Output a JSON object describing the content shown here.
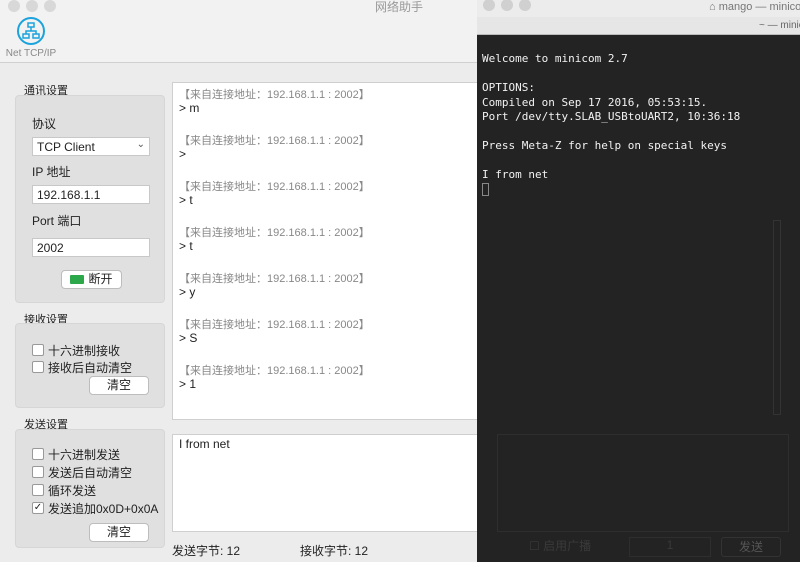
{
  "window": {
    "title": "网络助手",
    "tool_label": "Net TCP/IP"
  },
  "comm": {
    "title": "通讯设置",
    "protocol_label": "协议",
    "protocol_value": "TCP Client",
    "ip_label": "IP 地址",
    "ip_value": "192.168.1.1",
    "port_label": "Port 端口",
    "port_value": "2002",
    "disconnect_label": "断开"
  },
  "recv": {
    "title": "接收设置",
    "hex": "十六进制接收",
    "auto_clear": "接收后自动清空",
    "clear": "清空"
  },
  "send": {
    "title": "发送设置",
    "hex": "十六进制发送",
    "auto_clear": "发送后自动清空",
    "loop": "循环发送",
    "append": "发送追加0x0D+0x0A",
    "append_checked": true,
    "clear": "清空",
    "text": "I from net",
    "broadcast": "启用广播",
    "count": "1",
    "send_button": "发送"
  },
  "messages": [
    {
      "header": "【来自连接地址：192.168.1.1 : 2002】",
      "body": "> m"
    },
    {
      "header": "【来自连接地址：192.168.1.1 : 2002】",
      "body": ">"
    },
    {
      "header": "【来自连接地址：192.168.1.1 : 2002】",
      "body": "> t"
    },
    {
      "header": "【来自连接地址：192.168.1.1 : 2002】",
      "body": "> t"
    },
    {
      "header": "【来自连接地址：192.168.1.1 : 2002】",
      "body": "> y"
    },
    {
      "header": "【来自连接地址：192.168.1.1 : 2002】",
      "body": "> S"
    },
    {
      "header": "【来自连接地址：192.168.1.1 : 2002】",
      "body": "> 1"
    }
  ],
  "status": {
    "sent": "发送字节: 12",
    "received": "接收字节: 12"
  },
  "terminal": {
    "title": "mango — minicom",
    "subtitle": "~ — minicom",
    "lines": [
      "Welcome to minicom 2.7",
      "",
      "OPTIONS:",
      "Compiled on Sep 17 2016, 05:53:15.",
      "Port /dev/tty.SLAB_USBtoUART2, 10:36:18",
      "",
      "Press Meta-Z for help on special keys",
      "",
      "I from net"
    ]
  }
}
